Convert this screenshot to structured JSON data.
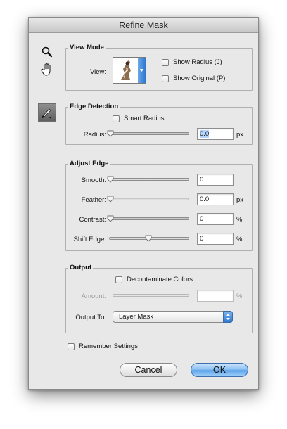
{
  "dialog": {
    "title": "Refine Mask"
  },
  "tools": {
    "zoom_icon": "magnifier-icon",
    "hand_icon": "hand-icon",
    "brush_icon": "refine-radius-brush-icon"
  },
  "view_mode": {
    "title": "View Mode",
    "view_label": "View:",
    "show_radius_label": "Show Radius (J)",
    "show_original_label": "Show Original (P)"
  },
  "edge_detection": {
    "title": "Edge Detection",
    "smart_radius_label": "Smart Radius",
    "radius_label": "Radius:",
    "radius_value": "0.0",
    "radius_unit": "px",
    "radius_slider": 0
  },
  "adjust_edge": {
    "title": "Adjust Edge",
    "smooth_label": "Smooth:",
    "smooth_value": "0",
    "smooth_slider": 0,
    "feather_label": "Feather:",
    "feather_value": "0.0",
    "feather_unit": "px",
    "feather_slider": 0,
    "contrast_label": "Contrast:",
    "contrast_value": "0",
    "contrast_unit": "%",
    "contrast_slider": 0,
    "shift_label": "Shift Edge:",
    "shift_value": "0",
    "shift_unit": "%",
    "shift_slider": 0.5
  },
  "output": {
    "title": "Output",
    "decontaminate_label": "Decontaminate Colors",
    "amount_label": "Amount:",
    "amount_value": "",
    "amount_unit": "%",
    "output_to_label": "Output To:",
    "output_to_value": "Layer Mask"
  },
  "footer": {
    "remember_label": "Remember Settings",
    "cancel_label": "Cancel",
    "ok_label": "OK"
  },
  "colors": {
    "accent": "#5ea3ea",
    "dialog_bg": "#e8e8e8"
  }
}
